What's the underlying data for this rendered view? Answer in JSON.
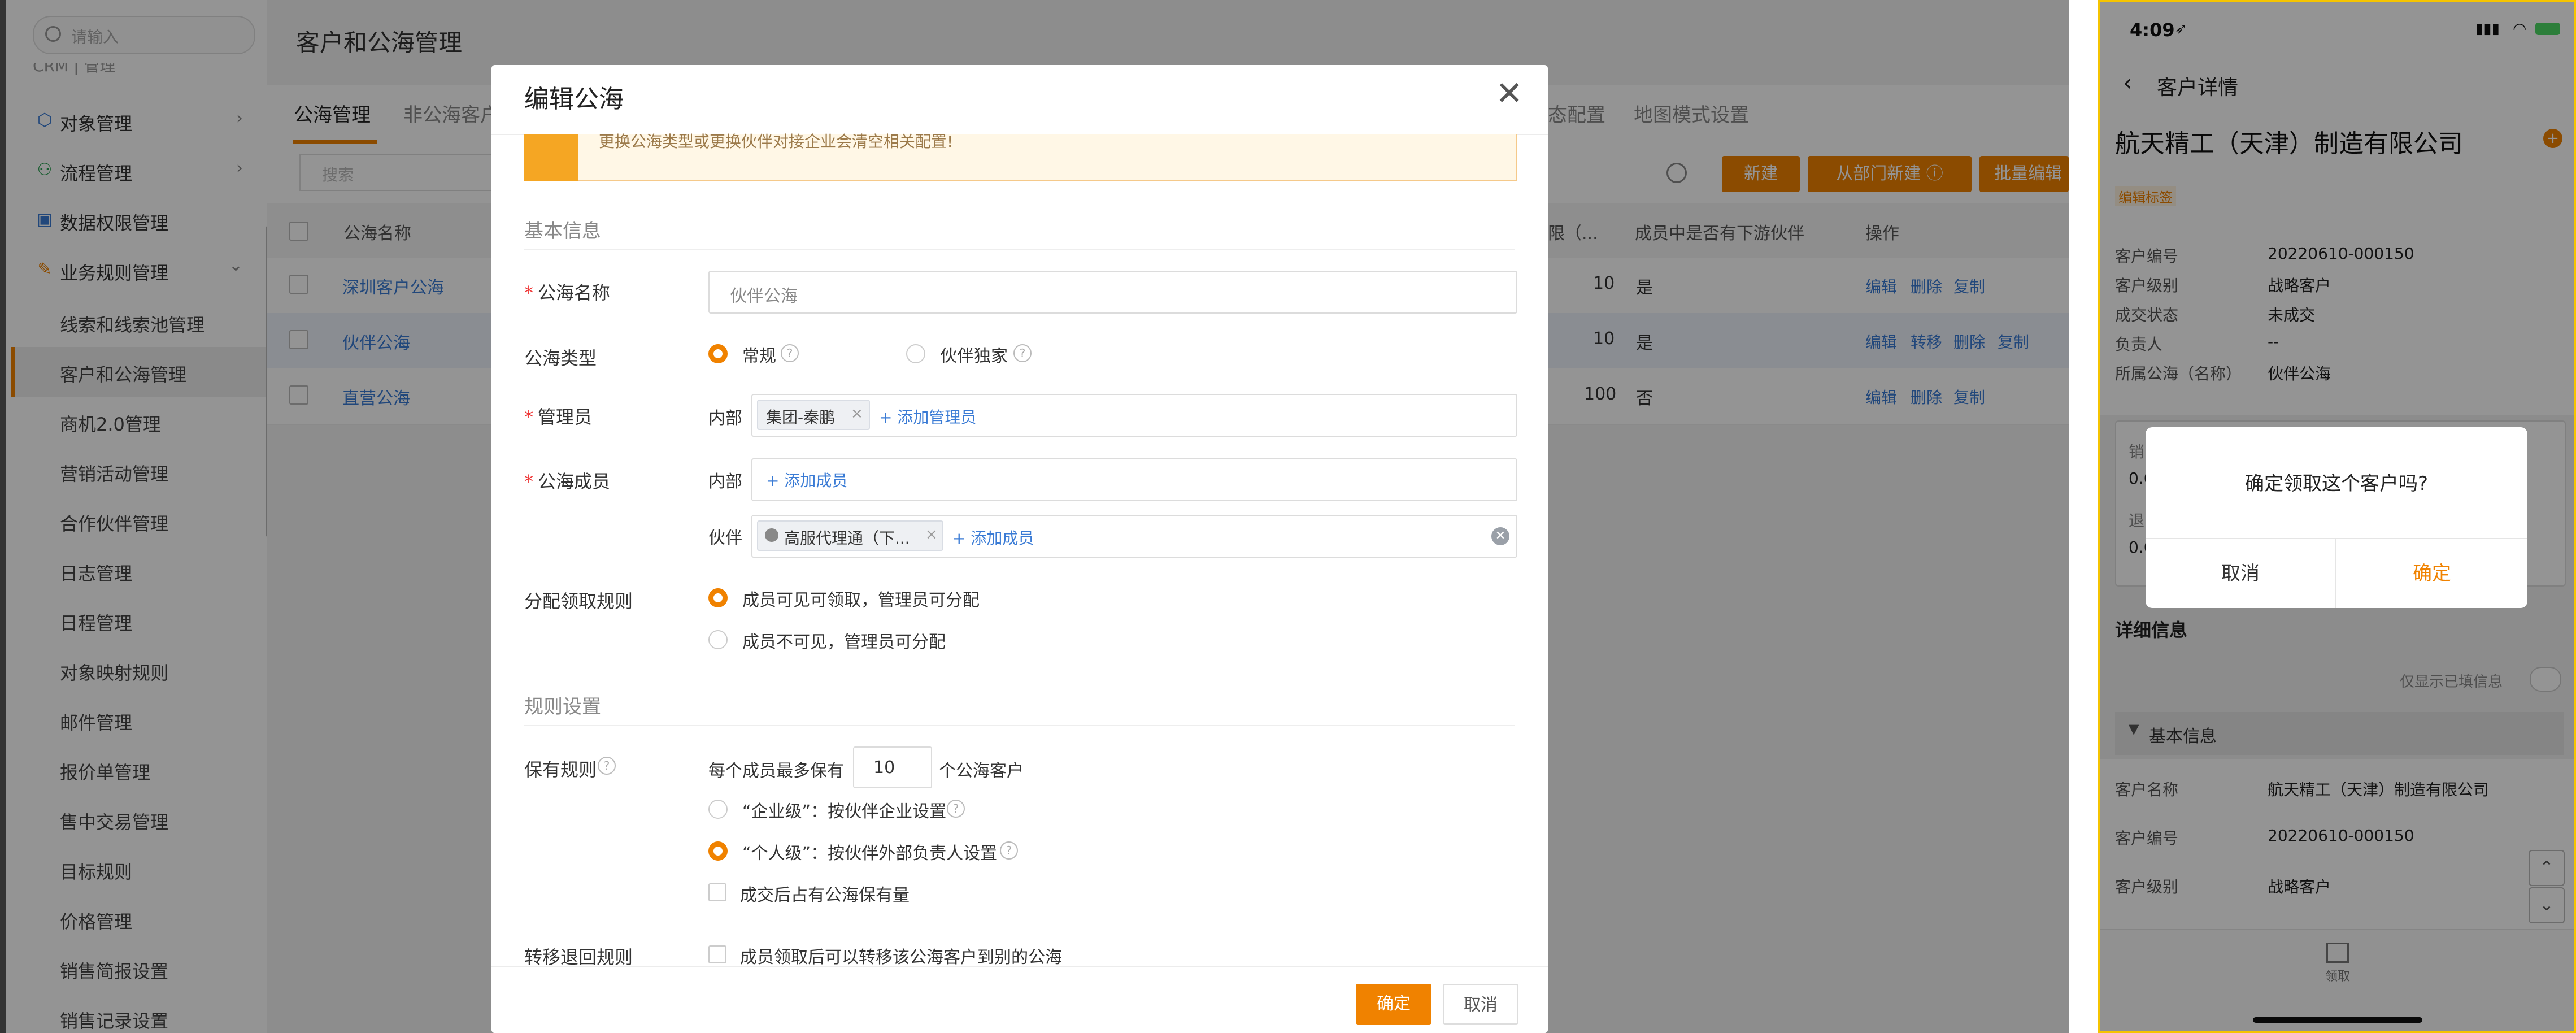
{
  "sidebar": {
    "search_placeholder": "请输入",
    "clipped_heading": "CRM | 管理",
    "items": [
      {
        "label": "对象管理",
        "icon": "cube-icon"
      },
      {
        "label": "流程管理",
        "icon": "flow-icon"
      },
      {
        "label": "数据权限管理",
        "icon": "lock-icon"
      },
      {
        "label": "业务规则管理",
        "icon": "wrench-icon"
      }
    ],
    "sub_items": [
      "线索和线索池管理",
      "客户和公海管理",
      "商机2.0管理",
      "营销活动管理",
      "合作伙伴管理",
      "日志管理",
      "日程管理",
      "对象映射规则",
      "邮件管理",
      "报价单管理",
      "售中交易管理",
      "目标规则",
      "价格管理",
      "销售简报设置",
      "销售记录设置"
    ]
  },
  "page": {
    "title": "客户和公海管理",
    "tabs": [
      "公海管理",
      "非公海客户",
      "态配置",
      "地图模式设置"
    ],
    "search_placeholder": "搜索",
    "buttons": {
      "new": "新建",
      "from_dept": "从部门新建",
      "batch_edit": "批量编辑"
    },
    "columns": {
      "name": "公海名称",
      "limit": "限（...",
      "has_partner": "成员中是否有下游伙伴",
      "ops": "操作"
    },
    "rows": [
      {
        "name": "深圳客户公海",
        "limit": "10",
        "has_partner": "是",
        "ops": [
          "编辑",
          "删除",
          "复制"
        ]
      },
      {
        "name": "伙伴公海",
        "limit": "10",
        "has_partner": "是",
        "ops": [
          "编辑",
          "转移",
          "删除",
          "复制"
        ]
      },
      {
        "name": "直营公海",
        "limit": "100",
        "has_partner": "否",
        "ops": [
          "编辑",
          "删除",
          "复制"
        ]
      }
    ]
  },
  "modal": {
    "title": "编辑公海",
    "notice": "更换公海类型或更换伙伴对接企业会清空相关配置!",
    "section_basic": "基本信息",
    "section_rules": "规则设置",
    "name_label": "公海名称",
    "name_value": "伙伴公海",
    "type_label": "公海类型",
    "type_options": [
      "常规",
      "伙伴独家"
    ],
    "admin_label": "管理员",
    "internal": "内部",
    "partner": "伙伴",
    "admin_tag": "集团-秦鹏",
    "add_admin": "+ 添加管理员",
    "members_label": "公海成员",
    "add_member": "+ 添加成员",
    "partner_tag": "高服代理通（下...",
    "assign_label": "分配领取规则",
    "assign_options": [
      "成员可见可领取，管理员可分配",
      "成员不可见，管理员可分配"
    ],
    "retain_label": "保有规则",
    "retain_prefix": "每个成员最多保有",
    "retain_value": "10",
    "retain_suffix": "个公海客户",
    "retain_options": [
      "“企业级”：按伙伴企业设置",
      "“个人级”：按伙伴外部负责人设置"
    ],
    "retain_check": "成交后占有公海保有量",
    "transfer_label": "转移退回规则",
    "transfer_check": "成员领取后可以转移该公海客户到别的公海",
    "ok": "确定",
    "cancel": "取消"
  },
  "phone": {
    "time": "4:09",
    "nav_title": "客户详情",
    "company": "航天精工（天津）制造有限公司",
    "edit_tag": "编辑标签",
    "fields": [
      {
        "label": "客户编号",
        "value": "20220610-000150"
      },
      {
        "label": "客户级别",
        "value": "战略客户"
      },
      {
        "label": "成交状态",
        "value": "未成交"
      },
      {
        "label": "负责人",
        "value": "--"
      },
      {
        "label": "所属公海（名称）",
        "value": "伙伴公海"
      }
    ],
    "card_frag": [
      "销",
      "0.0",
      "退",
      "0.0"
    ],
    "detail_title": "详细信息",
    "only_filled": "仅显示已填信息",
    "basic_section": "基本信息",
    "basic_fields": [
      {
        "label": "客户名称",
        "value": "航天精工（天津）制造有限公司"
      },
      {
        "label": "客户编号",
        "value": "20220610-000150"
      },
      {
        "label": "客户级别",
        "value": "战略客户"
      }
    ],
    "bottom_label": "领取",
    "dialog": {
      "message": "确定领取这个客户吗?",
      "cancel": "取消",
      "ok": "确定"
    }
  },
  "colors": {
    "accent": "#f08200",
    "link": "#3a7bd5"
  }
}
